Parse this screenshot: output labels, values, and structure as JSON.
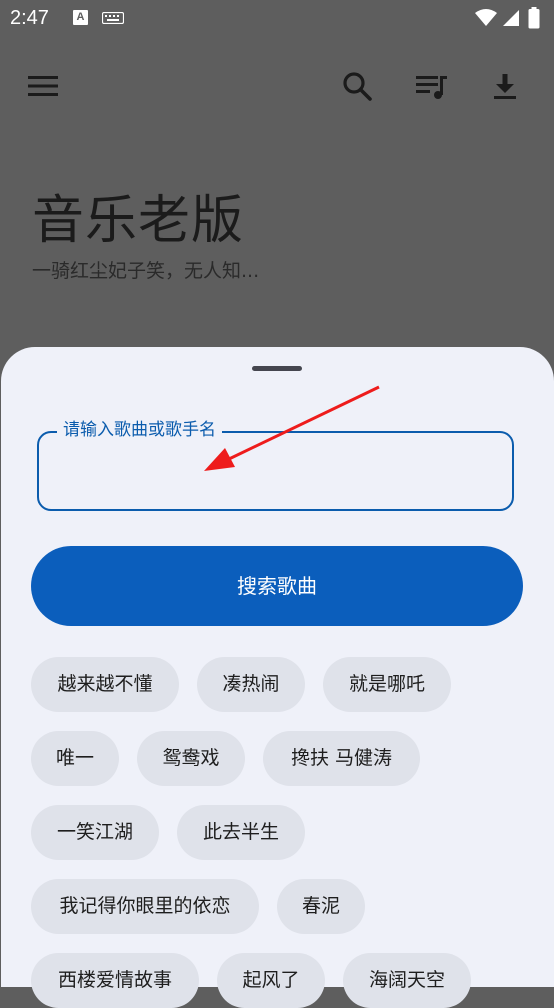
{
  "status_bar": {
    "time": "2:47",
    "notif_letter": "A"
  },
  "header": {
    "title": "音乐老版",
    "subtitle": "一骑红尘妃子笑，无人知..."
  },
  "search_sheet": {
    "input_label": "请输入歌曲或歌手名",
    "input_value": "",
    "search_button": "搜索歌曲"
  },
  "suggestions": [
    "越来越不懂",
    "凑热闹",
    "就是哪吒",
    "唯一",
    "鸳鸯戏",
    "搀扶  马健涛",
    "一笑江湖",
    "此去半生",
    "我记得你眼里的依恋",
    "春泥",
    "西楼爱情故事",
    "起风了",
    "海阔天空"
  ],
  "colors": {
    "scrim_background": "#5e5e5e",
    "sheet": "#eff1f9",
    "accent": "#0b5ebc",
    "chip": "#dfe2ea",
    "annotation_arrow": "#ee1c1c"
  },
  "icons": {
    "menu": "hamburger-menu-icon",
    "search": "search-icon",
    "playlist": "playlist-music-icon",
    "download": "download-icon"
  }
}
